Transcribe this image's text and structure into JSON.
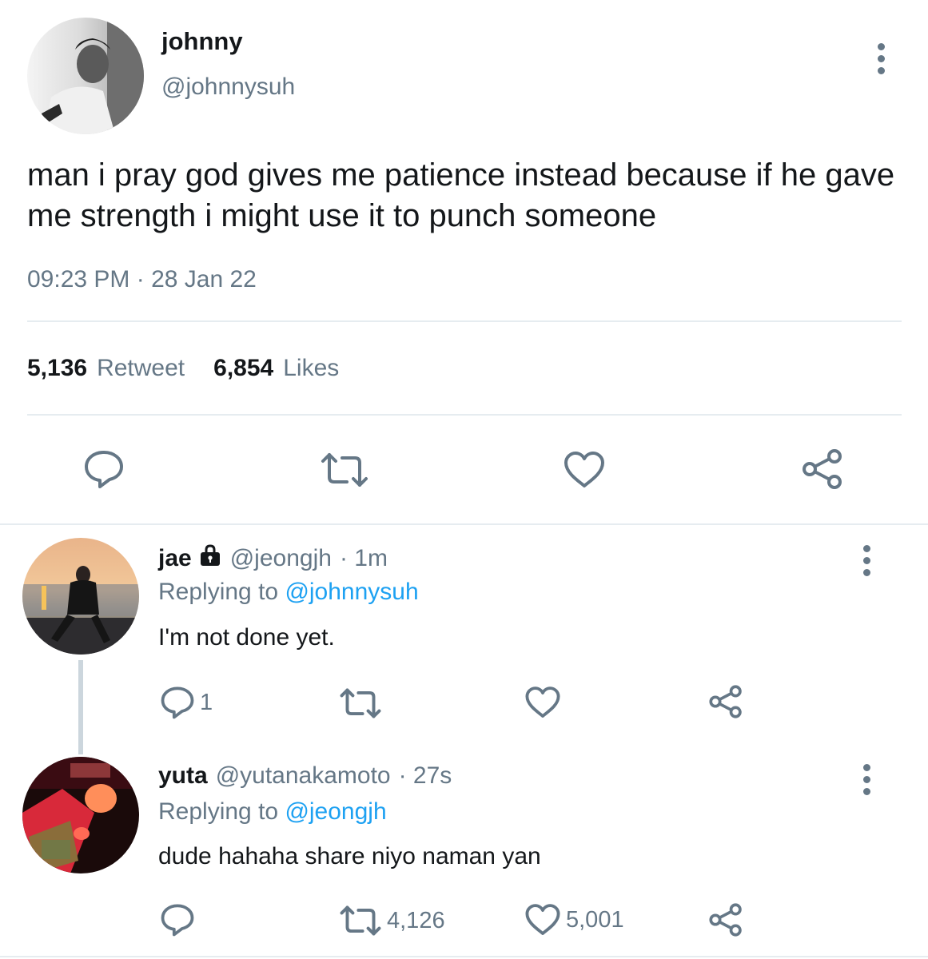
{
  "tweet": {
    "author_name": "johnny",
    "author_handle": "@johnnysuh",
    "text": "man i pray god gives me patience instead because if he gave me strength i might use it to punch someone",
    "timestamp": "09:23 PM · 28 Jan 22",
    "retweet_count": "5,136",
    "retweet_label": "Retweet",
    "like_count": "6,854",
    "like_label": "Likes",
    "icons": [
      "reply-icon",
      "retweet-icon",
      "like-icon",
      "share-icon",
      "more-icon"
    ]
  },
  "replies": [
    {
      "name": "jae",
      "lock_icon": "lock-icon",
      "handle": "@jeongjh",
      "time": "· 1m",
      "replying_label": "Replying to",
      "replying_to": "@johnnysuh",
      "text": "I'm not done yet.",
      "reply_count": "1",
      "retweet_count": "",
      "like_count": ""
    },
    {
      "name": "yuta",
      "handle": "@yutanakamoto",
      "time": "· 27s",
      "replying_label": "Replying to",
      "replying_to": "@jeongjh",
      "text": "dude hahaha share niyo naman yan",
      "reply_count": "",
      "retweet_count": "4,126",
      "like_count": "5,001"
    }
  ],
  "colors": {
    "text": "#14171a",
    "secondary": "#657786",
    "link": "#1da1f2",
    "divider": "#e6ecf0"
  }
}
